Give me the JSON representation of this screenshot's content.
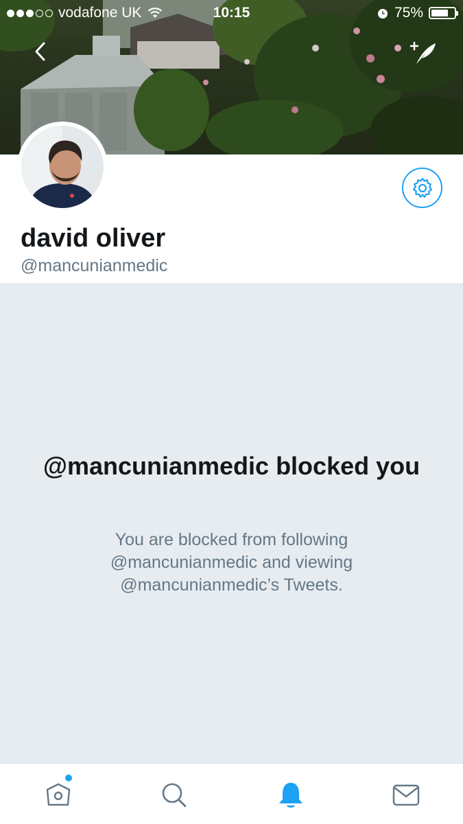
{
  "status_bar": {
    "carrier": "vodafone UK",
    "time": "10:15",
    "battery": "75%",
    "battery_level": 0.75,
    "signal_bars_filled": 3,
    "signal_bars_total": 5
  },
  "header": {
    "back_icon": "chevron-left-icon",
    "compose_icon": "compose-tweet-icon"
  },
  "profile": {
    "name": "david oliver",
    "handle": "@mancunianmedic",
    "settings_icon": "gear-icon"
  },
  "blocked": {
    "title": "@mancunianmedic blocked you",
    "description": "You are blocked from following @mancunianmedic and viewing @mancunianmedic’s Tweets."
  },
  "tab_bar": {
    "tabs": [
      {
        "icon": "home-icon",
        "active": false,
        "has_badge": true
      },
      {
        "icon": "search-icon",
        "active": false,
        "has_badge": false
      },
      {
        "icon": "notifications-bell-icon",
        "active": true,
        "has_badge": false
      },
      {
        "icon": "messages-envelope-icon",
        "active": false,
        "has_badge": false
      }
    ]
  },
  "colors": {
    "accent": "#1da1f2",
    "panel_bg": "#e6ecf0",
    "text_primary": "#14171a",
    "text_secondary": "#657786"
  }
}
